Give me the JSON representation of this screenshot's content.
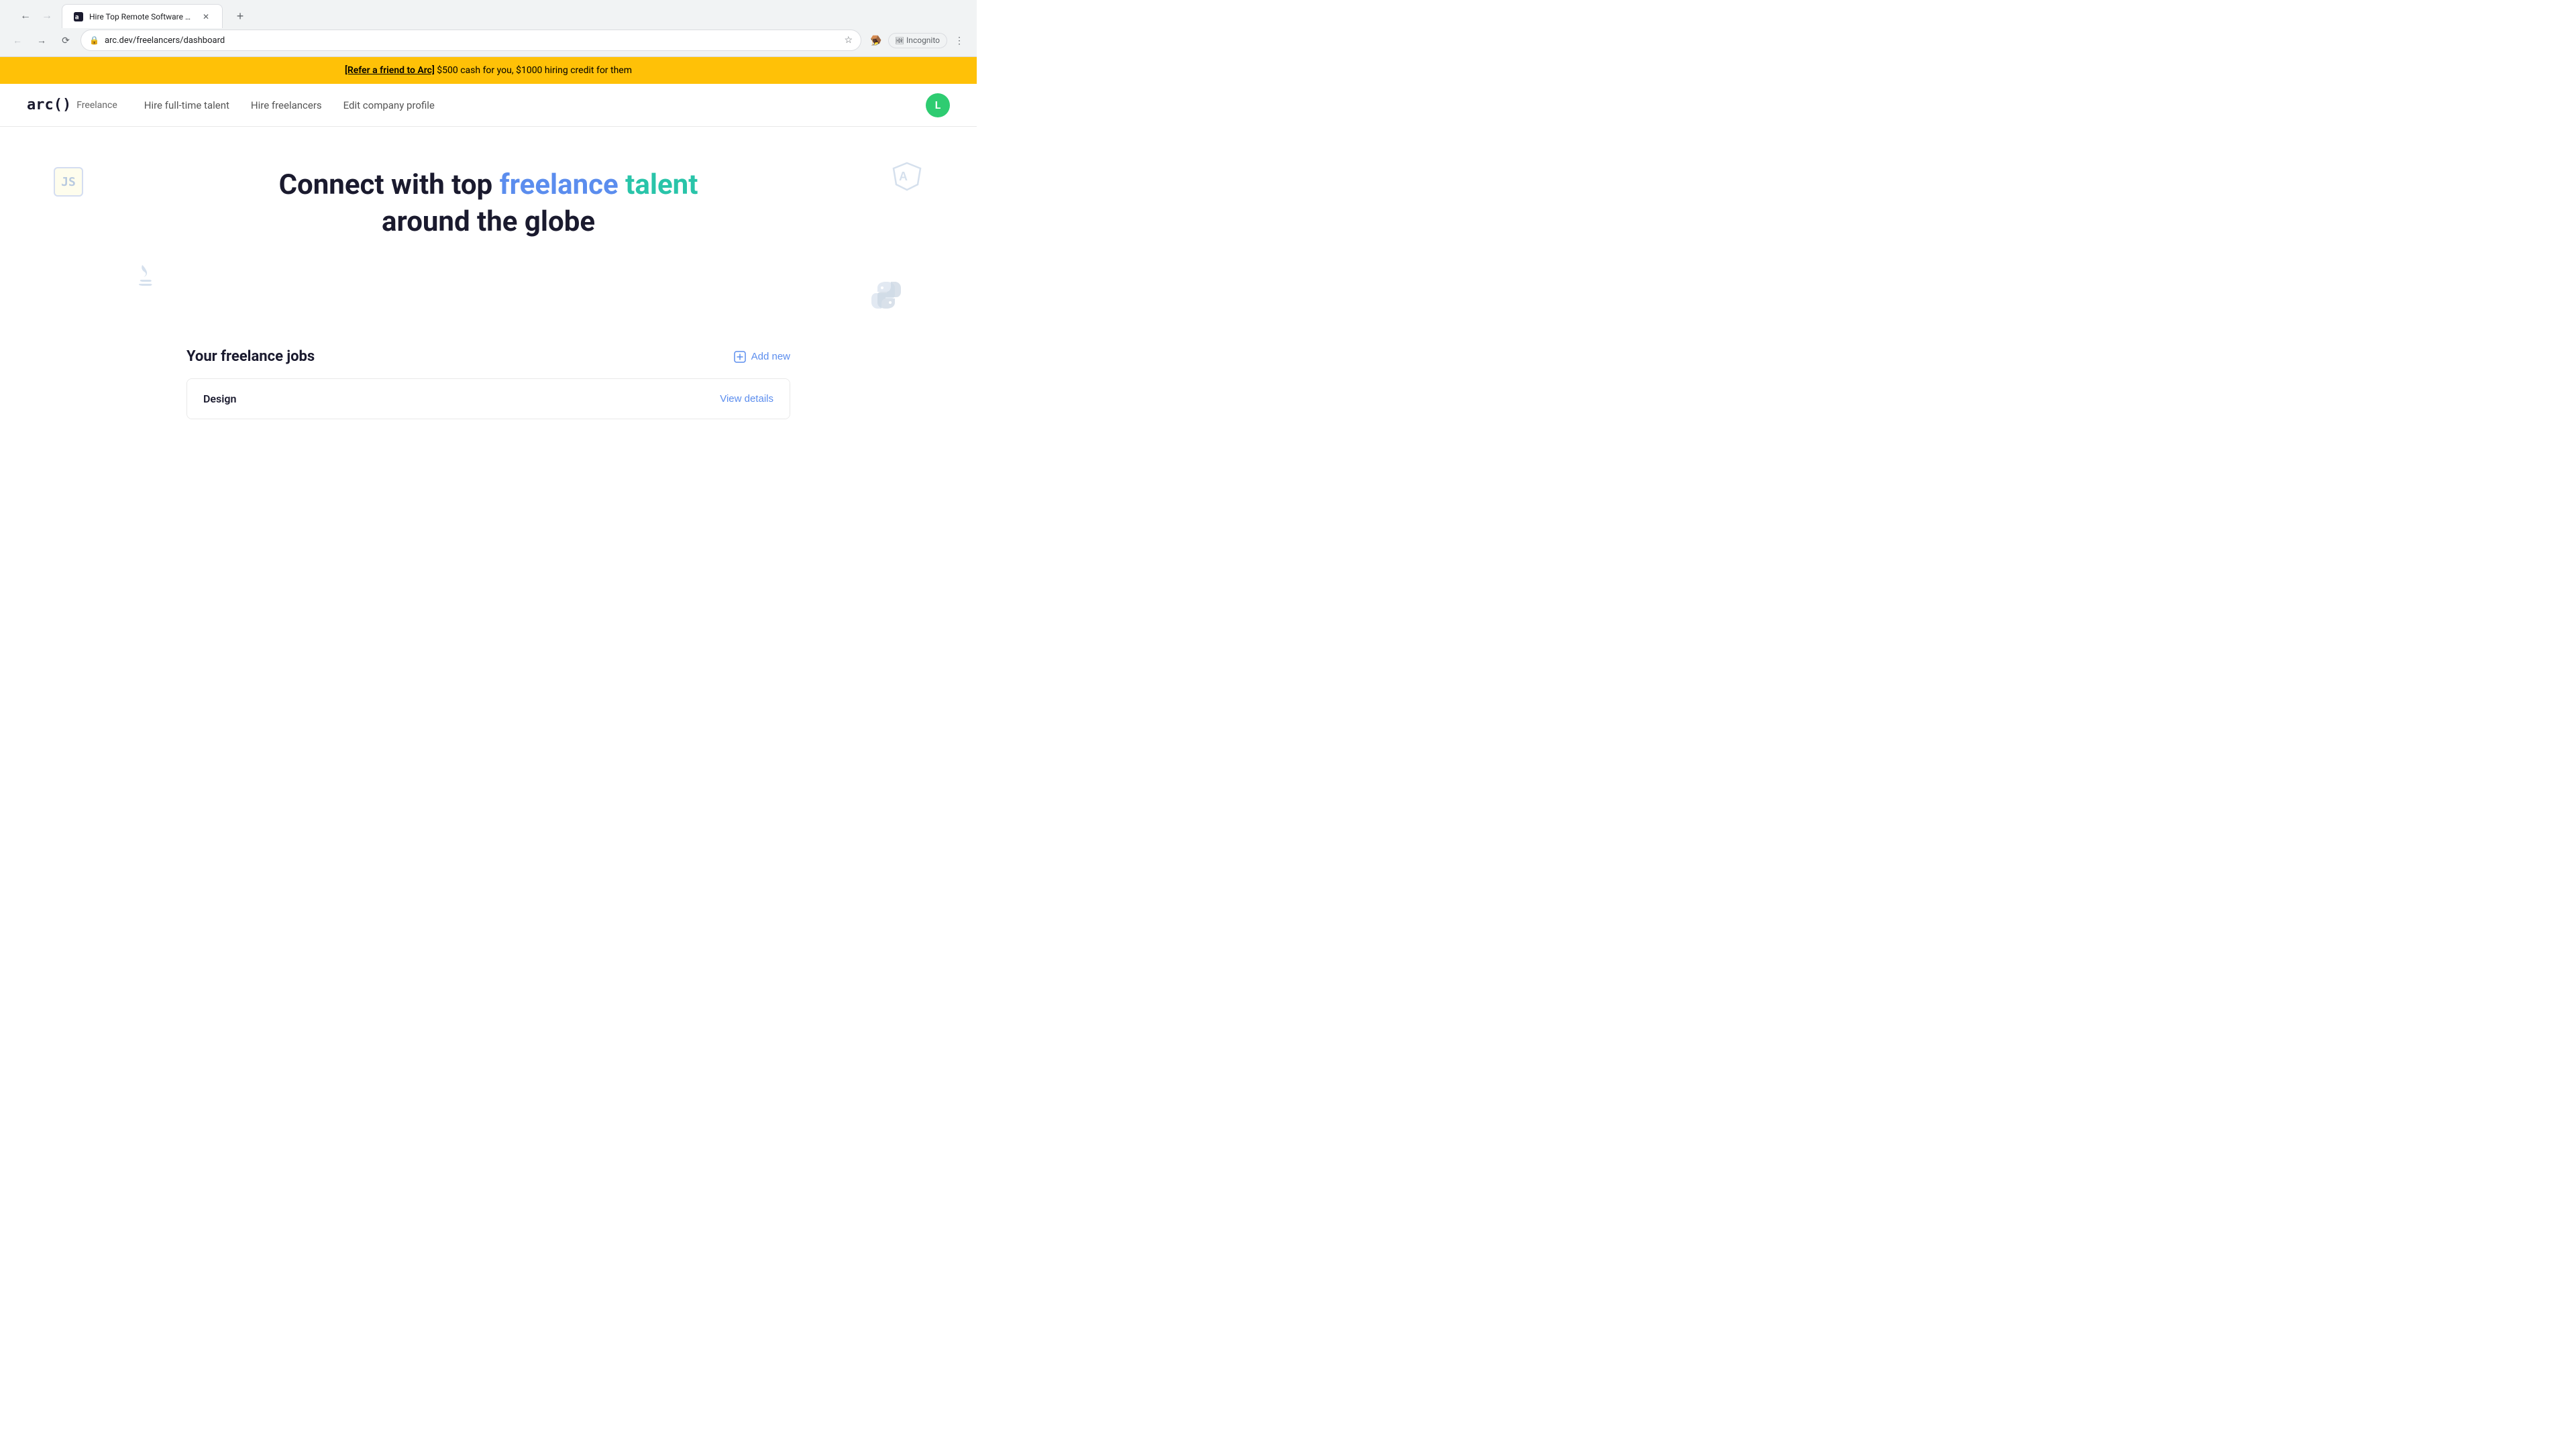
{
  "browser": {
    "tab_title": "Hire Top Remote Software Dev",
    "url": "arc.dev/freelancers/dashboard",
    "incognito_label": "Incognito",
    "new_tab_label": "+"
  },
  "banner": {
    "refer_link": "[Refer a friend to Arc]",
    "text": " $500 cash for you, $1000 hiring credit for them"
  },
  "nav": {
    "logo_arc": "arc()",
    "logo_label": "Freelance",
    "links": [
      {
        "label": "Hire full-time talent"
      },
      {
        "label": "Hire freelancers"
      },
      {
        "label": "Edit company profile"
      }
    ],
    "avatar_letter": "L"
  },
  "hero": {
    "title_part1": "Connect with top ",
    "title_highlight1": "freelance",
    "title_space": " ",
    "title_highlight2": "talent",
    "title_part2": "around the globe",
    "js_icon": "JS",
    "angular_icon": "A",
    "java_icon": "☕",
    "python_icon": "🐍"
  },
  "jobs": {
    "section_title": "Your freelance jobs",
    "add_new_label": "Add new",
    "items": [
      {
        "name": "Design",
        "view_label": "View details"
      }
    ]
  }
}
